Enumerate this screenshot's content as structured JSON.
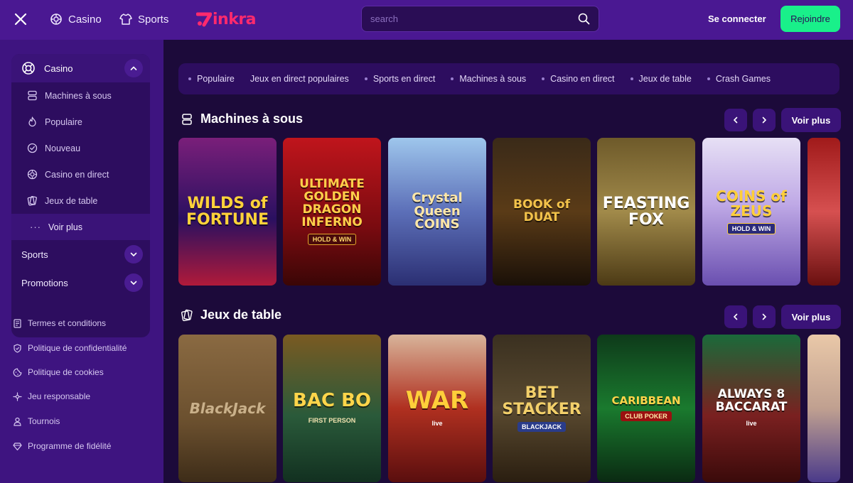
{
  "header": {
    "close_icon": "close-icon",
    "nav": [
      {
        "label": "Casino",
        "icon": "chip-icon"
      },
      {
        "label": "Sports",
        "icon": "jersey-icon"
      }
    ],
    "logo_text": "inkra",
    "search_placeholder": "search",
    "login_label": "Se connecter",
    "join_label": "Rejoindre",
    "accent": "#19f08a",
    "brand": "#ff2a6d"
  },
  "sidebar": {
    "casino": {
      "label": "Casino",
      "expanded": true
    },
    "casino_items": [
      {
        "label": "Machines à sous",
        "icon": "slot-icon"
      },
      {
        "label": "Populaire",
        "icon": "flame-icon"
      },
      {
        "label": "Nouveau",
        "icon": "new-badge-icon"
      },
      {
        "label": "Casino en direct",
        "icon": "chip-icon"
      },
      {
        "label": "Jeux de table",
        "icon": "cards-icon"
      }
    ],
    "more_label": "Voir plus",
    "groups": [
      {
        "label": "Sports",
        "icon": "jersey-icon"
      },
      {
        "label": "Promotions",
        "icon": "rocket-icon"
      }
    ],
    "footer_links": [
      {
        "label": "Termes et conditions",
        "icon": "document-icon"
      },
      {
        "label": "Politique de confidentialité",
        "icon": "shield-icon"
      },
      {
        "label": "Politique de cookies",
        "icon": "cookie-icon"
      },
      {
        "label": "Jeu responsable",
        "icon": "hand-icon"
      },
      {
        "label": "Tournois",
        "icon": "trophy-icon"
      },
      {
        "label": "Programme de fidélité",
        "icon": "diamond-icon"
      }
    ]
  },
  "categories": [
    "Populaire",
    "Jeux en direct populaires",
    "Sports en direct",
    "Machines à sous",
    "Casino en direct",
    "Jeux de table",
    "Crash Games"
  ],
  "sections": {
    "slots": {
      "title": "Machines à sous",
      "see_more": "Voir plus",
      "games": [
        {
          "title": "WILDS of FORTUNE",
          "sub": ""
        },
        {
          "title": "ULTIMATE GOLDEN DRAGON INFERNO",
          "sub": "HOLD & WIN"
        },
        {
          "title": "Crystal Queen COINS",
          "sub": ""
        },
        {
          "title": "BOOK of DUAT",
          "sub": ""
        },
        {
          "title": "FEASTING FOX",
          "sub": ""
        },
        {
          "title": "COINS of ZEUS",
          "sub": "HOLD & WIN"
        }
      ]
    },
    "table": {
      "title": "Jeux de table",
      "see_more": "Voir plus",
      "games": [
        {
          "title": "BlackJack",
          "sub": ""
        },
        {
          "title": "BAC BO",
          "sub": "FIRST PERSON"
        },
        {
          "title": "WAR",
          "sub": "live"
        },
        {
          "title": "BET STACKER",
          "sub": "BLACKJACK"
        },
        {
          "title": "CARIBBEAN",
          "sub": "CLUB POKER"
        },
        {
          "title": "ALWAYS 8 BACCARAT",
          "sub": "live"
        }
      ]
    }
  }
}
